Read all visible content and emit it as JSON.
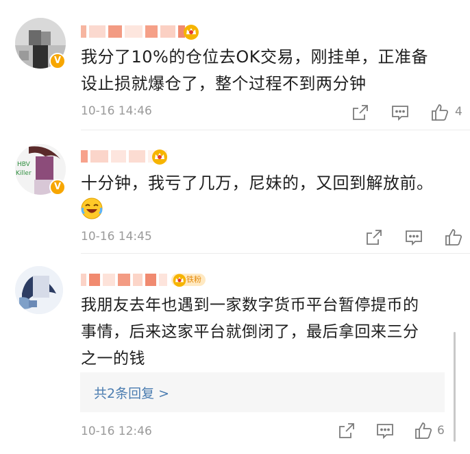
{
  "comments": [
    {
      "text": "我分了10%的仓位去OK交易，刚挂单，正准备设止损就爆仓了，整个过程不到两分钟",
      "line1": "我分了10%的仓位去OK交易，刚挂单，正准备",
      "line2": "设止损就爆仓了，整个过程不到两分钟",
      "time": "10-16 14:46",
      "likes": "4"
    },
    {
      "text": "十分钟，我亏了几万，尼妹的，又回到解放前。",
      "line1": "十分钟，我亏了几万，尼妹的，又回到解放前。",
      "time": "10-16 14:45",
      "likes": "",
      "avatar_text": [
        "HBV",
        "Killer"
      ]
    },
    {
      "text": "我朋友去年也遇到一家数字货币平台暂停提币的事情，后来这家平台就倒闭了，最后拿回来三分之一的钱",
      "line1": "我朋友去年也遇到一家数字货币平台暂停提币的",
      "line2": "事情，后来这家平台就倒闭了，最后拿回来三分",
      "line3": "之一的钱",
      "fans_badge": "铁粉",
      "replies_link": "共2条回复 >",
      "time": "10-16 12:46",
      "likes": "6"
    }
  ],
  "colors": {
    "badge": "#f7a600",
    "link": "#4a7cb0",
    "meta": "#9a9a9a"
  },
  "icons": [
    "v-verified-icon",
    "crown-icon",
    "share-icon",
    "comment-icon",
    "like-icon",
    "laughing-emoji-icon"
  ]
}
